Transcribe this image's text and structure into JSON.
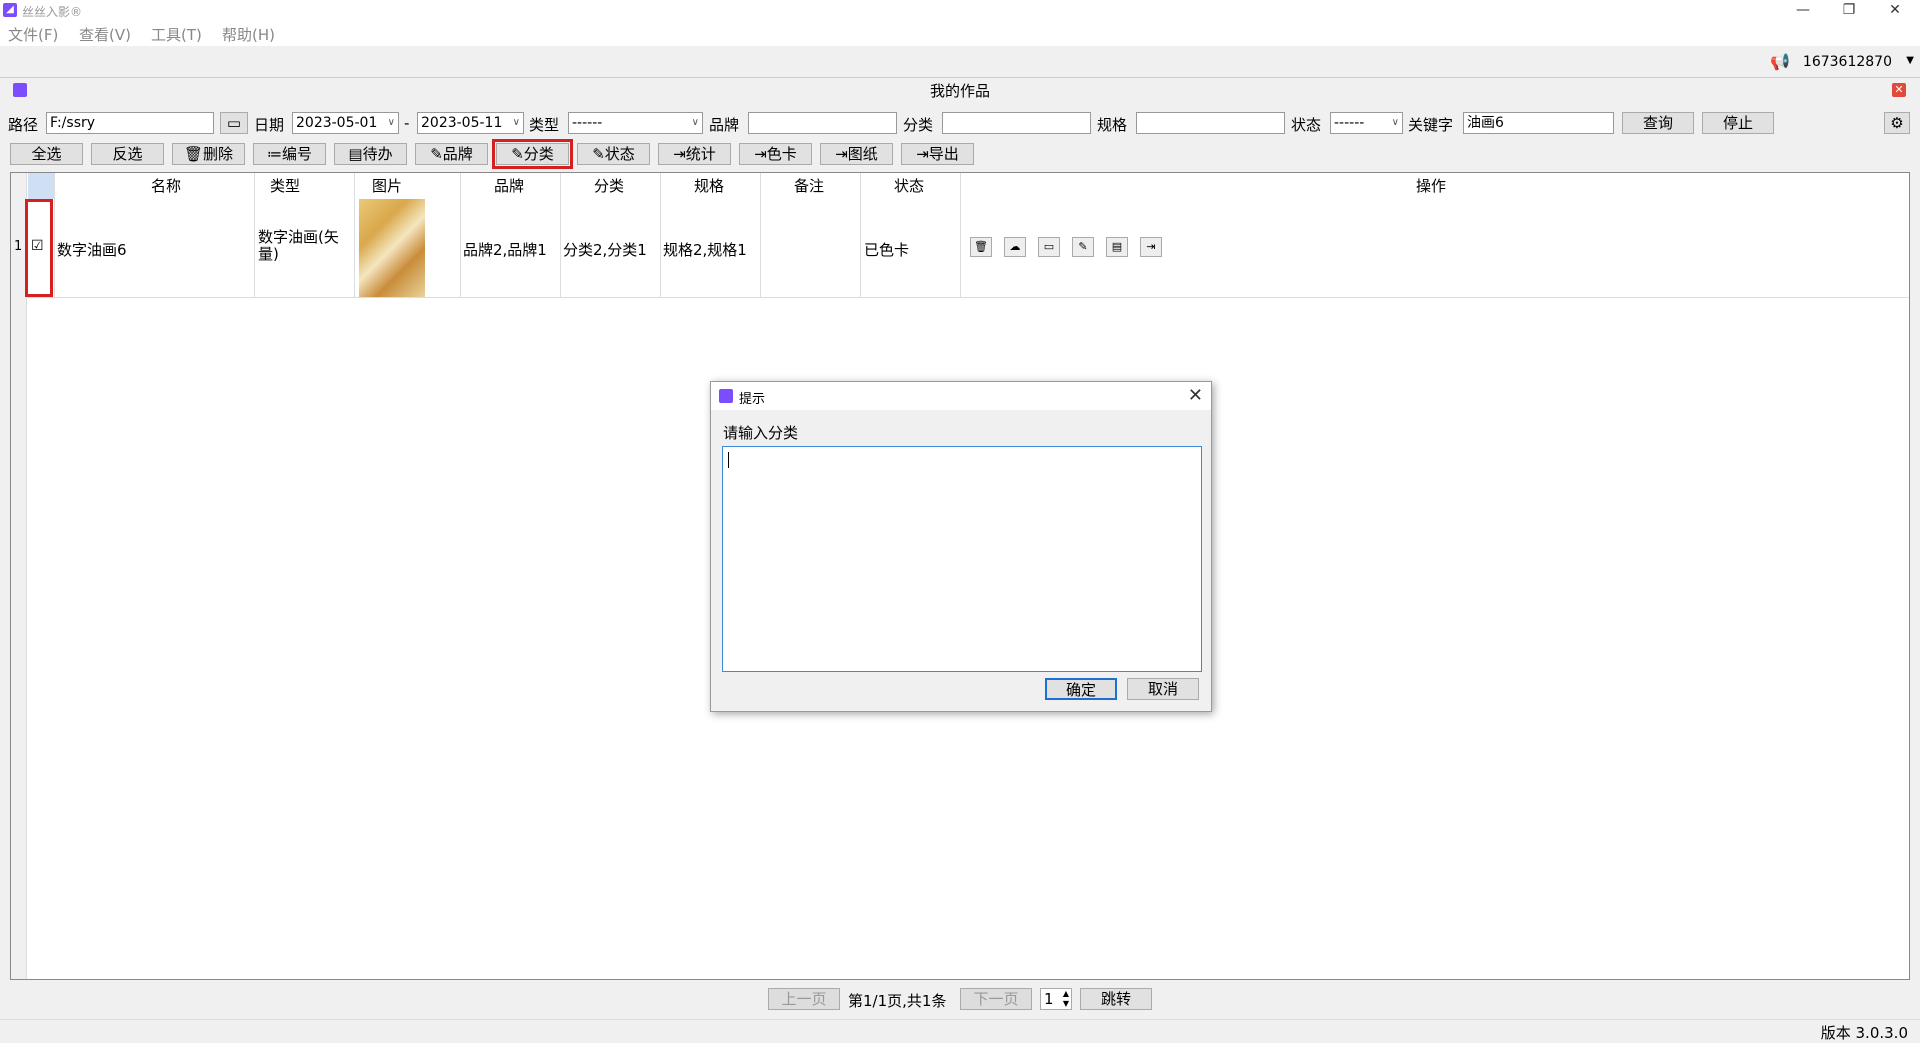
{
  "app": {
    "title": "丝丝入影®"
  },
  "menu": [
    "文件(F)",
    "查看(V)",
    "工具(T)",
    "帮助(H)"
  ],
  "account": {
    "id": "1673612870"
  },
  "window": {
    "title": "我的作品"
  },
  "filters": {
    "path_label": "路径",
    "path_value": "F:/ssry",
    "date_label": "日期",
    "date_from": "2023-05-01",
    "date_sep": "-",
    "date_to": "2023-05-11",
    "type_label": "类型",
    "type_value": "------",
    "brand_label": "品牌",
    "brand_value": "",
    "category_label": "分类",
    "category_value": "",
    "spec_label": "规格",
    "spec_value": "",
    "status_label": "状态",
    "status_value": "------",
    "keyword_label": "关键字",
    "keyword_value": "油画6",
    "query_button": "查询",
    "stop_button": "停止"
  },
  "actions": {
    "select_all": "全选",
    "invert": "反选",
    "delete": "删除",
    "number": "编号",
    "todo": "待办",
    "brand": "品牌",
    "category": "分类",
    "status": "状态",
    "stats": "统计",
    "color_card": "色卡",
    "drawing": "图纸",
    "export": "导出"
  },
  "table": {
    "headers": [
      "名称",
      "类型",
      "图片",
      "品牌",
      "分类",
      "规格",
      "备注",
      "状态",
      "操作"
    ],
    "rows": [
      {
        "index": "1",
        "checked": true,
        "name": "数字油画6",
        "type": "数字油画(矢量)",
        "brand": "品牌2,品牌1",
        "category": "分类2,分类1",
        "spec": "规格2,规格1",
        "note": "",
        "status": "已色卡"
      }
    ]
  },
  "pagination": {
    "prev": "上一页",
    "info": "第1/1页,共1条",
    "next": "下一页",
    "page": "1",
    "jump": "跳转"
  },
  "version": "版本 3.0.3.0",
  "dialog": {
    "title": "提示",
    "prompt": "请输入分类",
    "value": "",
    "ok": "确定",
    "cancel": "取消"
  },
  "colors": {
    "accent": "#7c4dff",
    "highlight": "#d42020",
    "focus": "#3c8bd8"
  }
}
